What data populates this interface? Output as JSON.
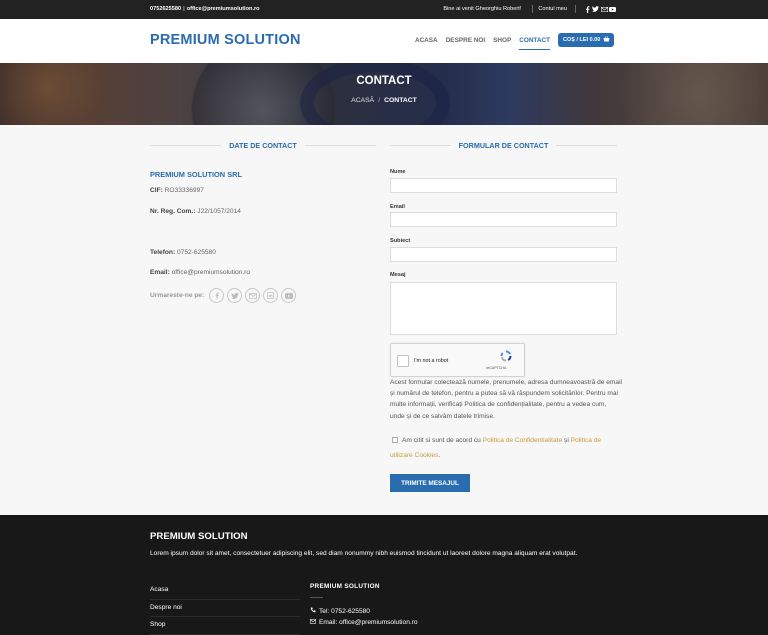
{
  "topbar": {
    "phone": "0752625580",
    "email": "office@premiumsolution.ro",
    "welcome": "Bine ai venit Gheorghiu Robert!",
    "account": "Contul meu",
    "social_icons": [
      "facebook-icon",
      "twitter-icon",
      "email-icon",
      "youtube-icon"
    ]
  },
  "header": {
    "logo": "PREMIUM SOLUTION",
    "nav": [
      "ACASA",
      "DESPRE NOI",
      "SHOP",
      "CONTACT"
    ],
    "active_nav": "CONTACT",
    "cart_label": "COȘ / LEI 0.00",
    "accent_color": "#2a6cb0"
  },
  "hero": {
    "title": "CONTACT",
    "breadcrumb_home": "ACASĂ",
    "breadcrumb_separator": "/",
    "breadcrumb_current": "CONTACT"
  },
  "contact": {
    "section_title": "DATE DE CONTACT",
    "company": "PREMIUM SOLUTION SRL",
    "cif_label": "CIF:",
    "cif_value": "RO33336997",
    "reg_label": "Nr. Reg. Com.:",
    "reg_value": "J22/1057/2014",
    "phone_label": "Telefon:",
    "phone_value": "0752-625580",
    "email_label": "Email:",
    "email_value": "office@premiumsolution.ro",
    "follow_label": "Urmareste-ne pe:",
    "follow_icons": [
      "facebook-icon",
      "twitter-icon",
      "email-icon",
      "linkedin-icon",
      "youtube-icon"
    ]
  },
  "form": {
    "section_title": "FORMULAR DE CONTACT",
    "name_label": "Nume",
    "email_label": "Email",
    "subject_label": "Subiect",
    "message_label": "Mesaj",
    "captcha_text": "I'm not a robot",
    "captcha_brand": "reCAPTCHA",
    "notice": "Acest formular colectează numele, prenumele, adresa dumneavoastră de email și numărul de telefon, pentru a putea să vă răspundem solicitărilor. Pentru mai multe informații, verificați Politica de confidențialitate, pentru a vedea cum, unde și de ce salvăm datele trimise.",
    "consent_prefix": "Am citit si sunt de acord cu",
    "consent_link1": "Politica de Confidentialitate",
    "consent_and": "și",
    "consent_link2": "Politica de utilizare Cookies",
    "consent_suffix": ".",
    "submit_label": "TRIMITE MESAJUL"
  },
  "footer": {
    "title": "PREMIUM SOLUTION",
    "text": "Lorem ipsum dolor sit amet, consectetuer adipiscing elit, sed diam nonummy nibh euismod tincidunt ut laoreet dolore magna aliquam erat volutpat.",
    "menu": [
      "Acasa",
      "Despre noi",
      "Shop"
    ],
    "col_title": "PREMIUM SOLUTION",
    "tel": "Tel: 0752-625580",
    "email": "Email: office@premiumsolution.ro"
  }
}
